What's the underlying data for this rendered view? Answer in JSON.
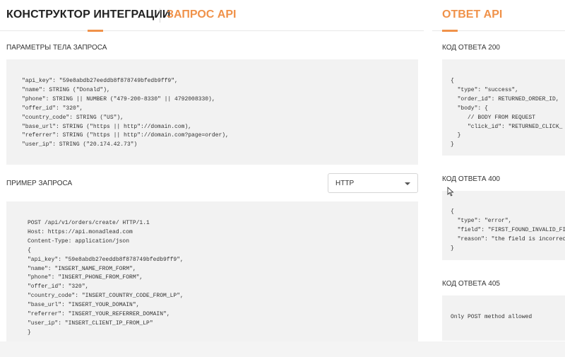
{
  "header": {
    "title": "КОНСТРУКТОР ИНТЕГРАЦИИ",
    "subtitle": "ЗАПРОС API",
    "response_title": "ОТВЕТ API"
  },
  "request": {
    "params_label": "ПАРАМЕТРЫ ТЕЛА ЗАПРОСА",
    "params_code": "\"api_key\": \"59e8abdb27eeddb8f878749bfedb9ff9\",\n\"name\": STRING (\"Donald\"),\n\"phone\": STRING || NUMBER (\"479-200-8330\" || 4792008330),\n\"offer_id\": \"320\",\n\"country_code\": STRING (\"US\"),\n\"base_url\": STRING (\"https || http\"://domain.com),\n\"referrer\": STRING (\"https || http\"://domain.com?page=order),\n\"user_ip\": STRING (\"20.174.42.73\")",
    "example_label": "ПРИМЕР ЗАПРОСА",
    "format_select": "HTTP",
    "example_code": "POST /api/v1/orders/create/ HTTP/1.1\nHost: https://api.monadlead.com\nContent-Type: application/json\n{\n\"api_key\": \"59e8abdb27eeddb8f878749bfedb9ff9\",\n\"name\": \"INSERT_NAME_FROM_FORM\",\n\"phone\": \"INSERT_PHONE_FROM_FORM\",\n\"offer_id\": \"320\",\n\"country_code\": \"INSERT_COUNTRY_CODE_FROM_LP\",\n\"base_url\": \"INSERT_YOUR_DOMAIN\",\n\"referrer\": \"INSERT_YOUR_REFERRER_DOMAIN\",\n\"user_ip\": \"INSERT_CLIENT_IP_FROM_LP\"\n}"
  },
  "response": {
    "code200_label": "КОД ОТВЕТА 200",
    "code200": "{\n  \"type\": \"success\",\n  \"order_id\": RETURNED_ORDER_ID,\n  \"body\": {\n     // BODY FROM REQUEST\n     \"click_id\": \"RETURNED_CLICK_\n  }\n}",
    "code400_label": "КОД ОТВЕТА 400",
    "code400": "{\n  \"type\": \"error\",\n  \"field\": \"FIRST_FOUND_INVALID_FI\n  \"reason\": \"the field is incorrec\n}",
    "code405_label": "КОД ОТВЕТА 405",
    "code405": "Only POST method allowed"
  },
  "colors": {
    "accent": "#f0924a",
    "code_bg": "#f2f2f2"
  }
}
